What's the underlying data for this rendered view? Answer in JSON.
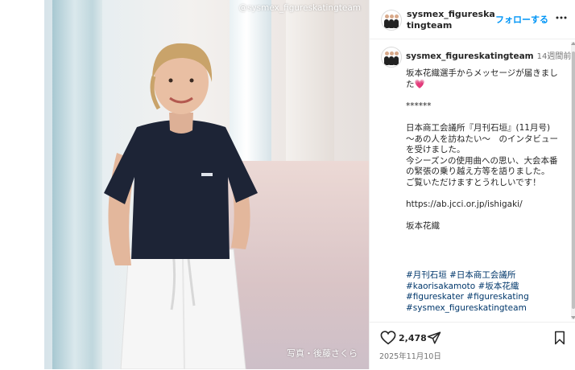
{
  "photo": {
    "watermark": "@sysmex_figureskatingteam",
    "credit": "写真・後藤さくら"
  },
  "header": {
    "account_name": "sysmex_figureskatingteam",
    "follow_label": "フォローする"
  },
  "post": {
    "author": "sysmex_figureskatingteam",
    "time_ago": "14週間前",
    "caption": "坂本花織選手からメッセージが届きました💗\n\n******\n\n日本商工会議所『月刊石垣』(11月号)\n〜あの人を訪ねたい〜　のインタビューを受けました。\n今シーズンの使用曲への思い、大会本番の緊張の乗り越え方等を語りました。\nご覧いただけますとうれしいです！\n\nhttps://ab.jcci.or.jp/ishigaki/\n\n坂本花織",
    "hashtags": [
      "#月刊石垣 #日本商工会議所",
      "#kaorisakamoto #坂本花織",
      "#figureskater #figureskating",
      "#sysmex_figureskatingteam"
    ]
  },
  "footer": {
    "like_count": "2,478",
    "date": "2025年11月10日"
  },
  "icons": {
    "like": "heart-icon",
    "share": "paper-plane-icon",
    "save": "bookmark-icon",
    "more": "more-icon"
  },
  "colors": {
    "follow": "#0095f6",
    "hashtag": "#00376b",
    "muted": "#737373"
  }
}
